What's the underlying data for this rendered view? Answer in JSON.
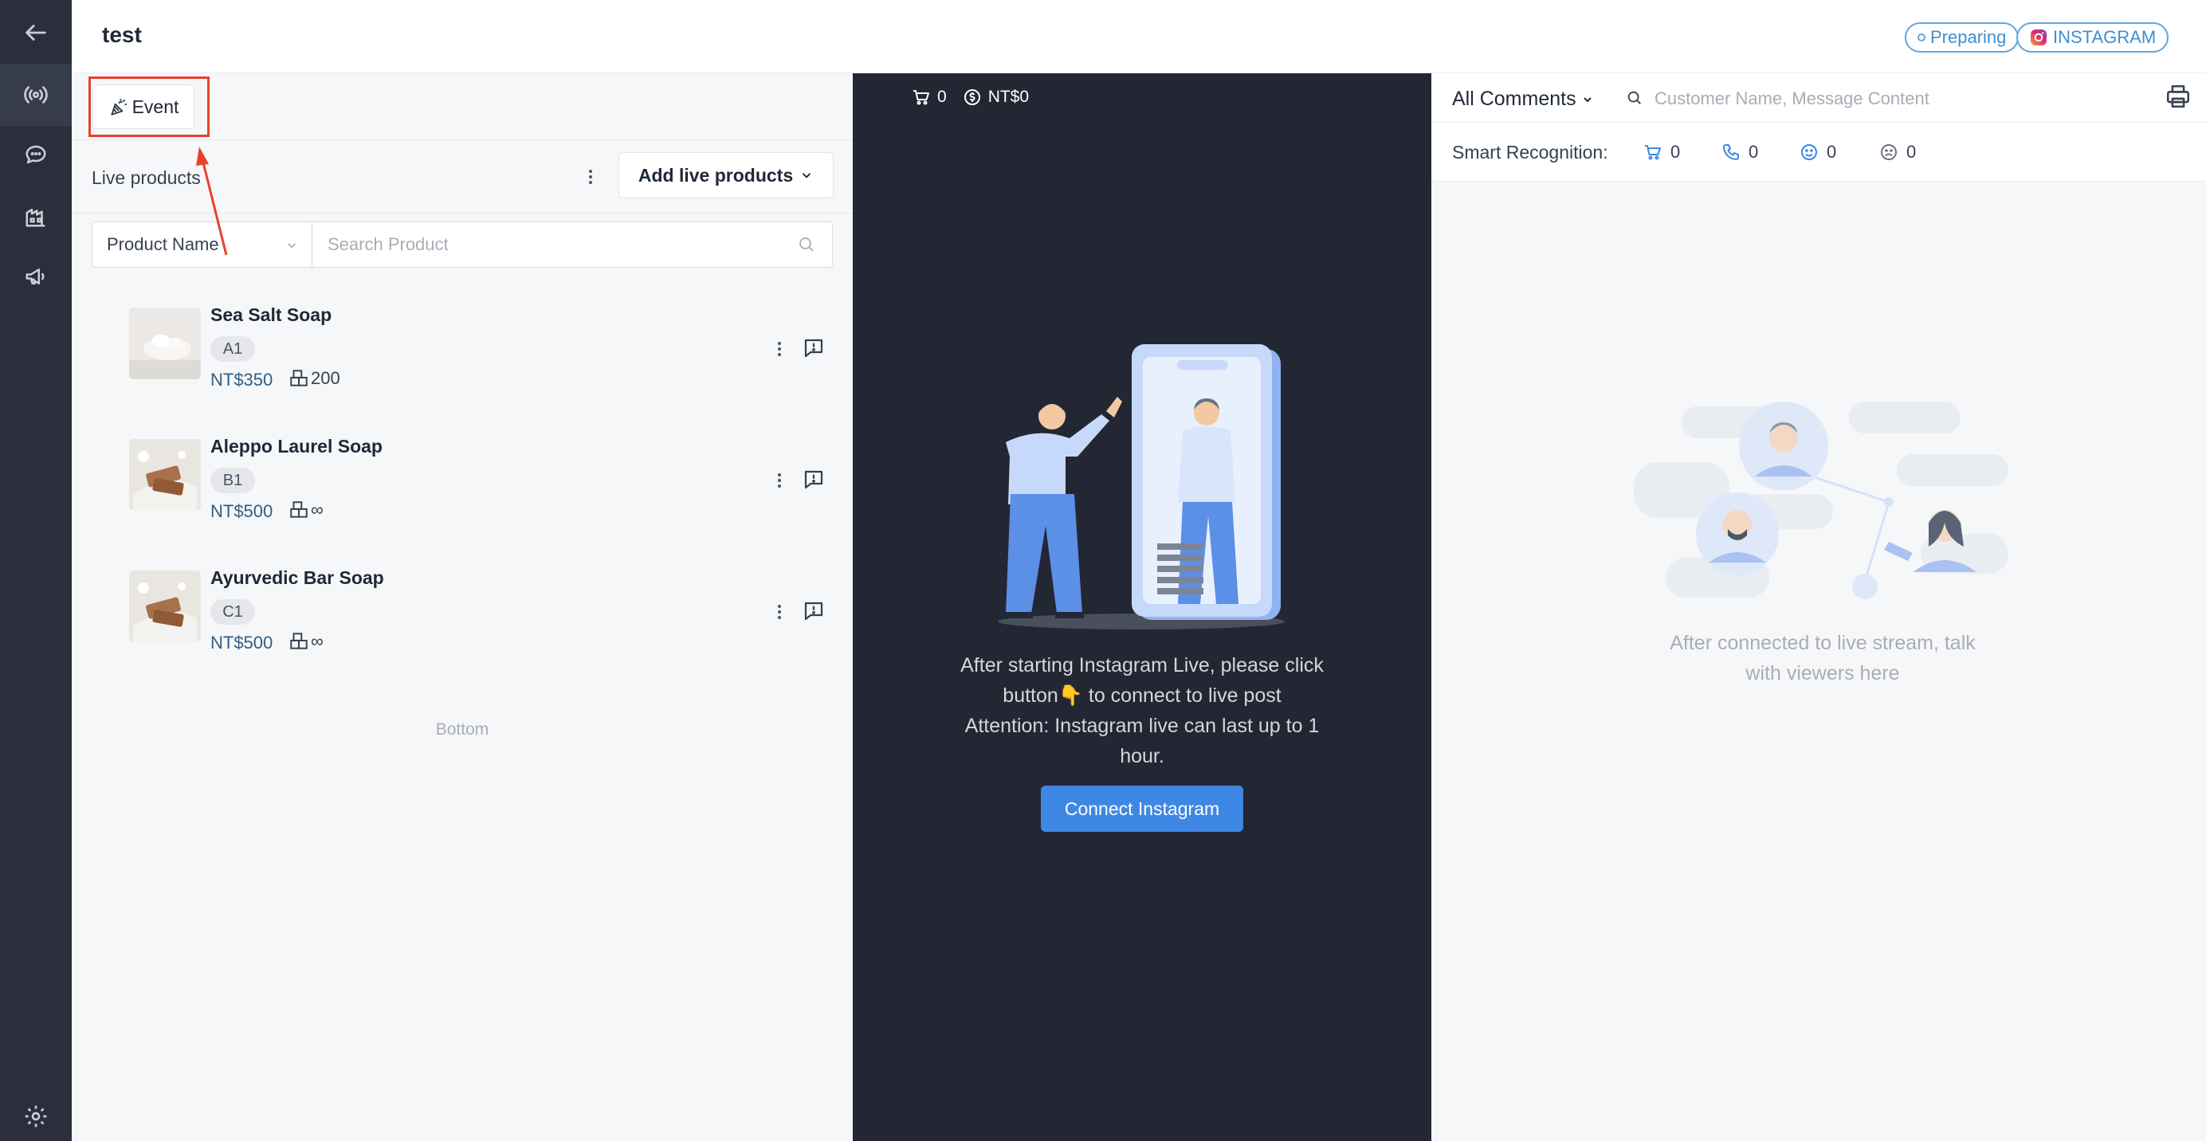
{
  "header": {
    "title": "test",
    "status_label": "Preparing",
    "platform_label": "INSTAGRAM"
  },
  "sidebar": {
    "items": [
      {
        "icon": "back-arrow-icon"
      },
      {
        "icon": "live-broadcast-icon",
        "active": true
      },
      {
        "icon": "chat-icon"
      },
      {
        "icon": "warehouse-icon"
      },
      {
        "icon": "megaphone-icon"
      },
      {
        "icon": "gear-icon"
      }
    ]
  },
  "left": {
    "event_label": "Event",
    "live_products_label": "Live products",
    "add_products_label": "Add live products",
    "search": {
      "select_value": "Product Name",
      "placeholder": "Search Product"
    },
    "products": [
      {
        "name": "Sea Salt Soap",
        "sku": "A1",
        "price": "NT$350",
        "stock": "200"
      },
      {
        "name": "Aleppo Laurel Soap",
        "sku": "B1",
        "price": "NT$500",
        "stock": "∞"
      },
      {
        "name": "Ayurvedic Bar Soap",
        "sku": "C1",
        "price": "NT$500",
        "stock": "∞"
      }
    ],
    "bottom_text": "Bottom"
  },
  "center": {
    "cart_count": "0",
    "total_amount": "NT$0",
    "message_line1": "After starting Instagram Live, please click button👇 to connect to live post",
    "message_line2": "Attention: Instagram live can last up to 1 hour.",
    "connect_label": "Connect Instagram"
  },
  "right": {
    "filter_label": "All Comments",
    "search_placeholder": "Customer Name, Message Content",
    "smart_label": "Smart Recognition:",
    "smart_counts": {
      "cart": "0",
      "phone": "0",
      "positive": "0",
      "negative": "0"
    },
    "empty_message": "After connected to live stream, talk with viewers here"
  },
  "colors": {
    "sidebar_bg": "#2a2f3b",
    "center_bg": "#232733",
    "accent_blue": "#3f87e4",
    "highlight_red": "#e8412c"
  }
}
